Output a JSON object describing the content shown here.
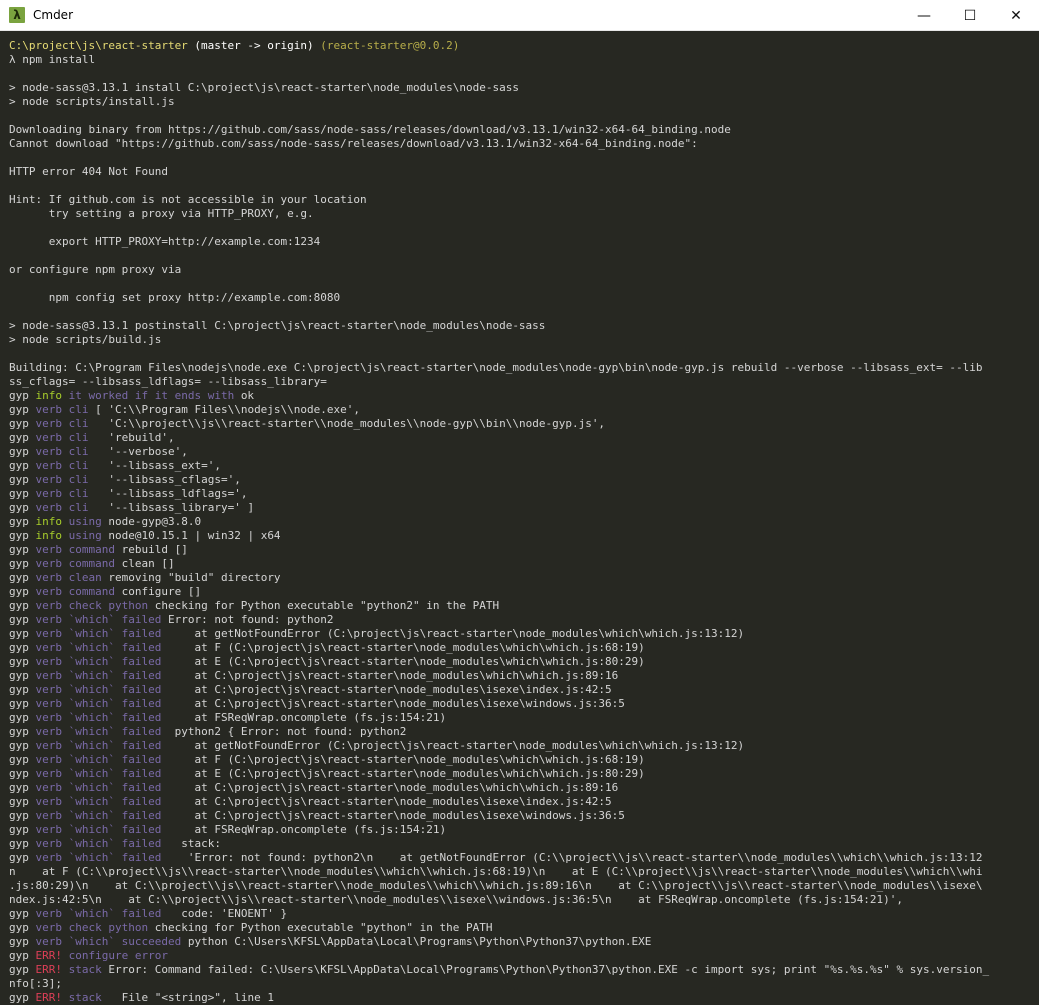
{
  "window": {
    "title": "Cmder",
    "icon": "lambda-icon",
    "icon_glyph": "λ",
    "controls": {
      "minimize": "—",
      "maximize": "☐",
      "close": "✕"
    }
  },
  "colors": {
    "background": "#272822",
    "text": "#d5d5d5",
    "path": "#e6db74",
    "package": "#b8ae4a",
    "info": "#a6cc2b",
    "verb": "#7a6aa8",
    "error": "#dd3f57"
  },
  "terminal": {
    "lines": [
      [
        [
          "C:\\project\\js\\react-starter",
          "path"
        ],
        [
          " (master -> origin)",
          "git"
        ],
        [
          " (react-starter@0.0.2)",
          "pkg"
        ]
      ],
      [
        [
          "λ npm install",
          "default"
        ]
      ],
      [
        [
          "",
          "default"
        ]
      ],
      [
        [
          "> node-sass@3.13.1 install C:\\project\\js\\react-starter\\node_modules\\node-sass",
          "default"
        ]
      ],
      [
        [
          "> node scripts/install.js",
          "default"
        ]
      ],
      [
        [
          "",
          "default"
        ]
      ],
      [
        [
          "Downloading binary from https://github.com/sass/node-sass/releases/download/v3.13.1/win32-x64-64_binding.node",
          "default"
        ]
      ],
      [
        [
          "Cannot download \"https://github.com/sass/node-sass/releases/download/v3.13.1/win32-x64-64_binding.node\":",
          "default"
        ]
      ],
      [
        [
          "",
          "default"
        ]
      ],
      [
        [
          "HTTP error 404 Not Found",
          "default"
        ]
      ],
      [
        [
          "",
          "default"
        ]
      ],
      [
        [
          "Hint: If github.com is not accessible in your location",
          "default"
        ]
      ],
      [
        [
          "      try setting a proxy via HTTP_PROXY, e.g.",
          "default"
        ]
      ],
      [
        [
          "",
          "default"
        ]
      ],
      [
        [
          "      export HTTP_PROXY=http://example.com:1234",
          "default"
        ]
      ],
      [
        [
          "",
          "default"
        ]
      ],
      [
        [
          "or configure npm proxy via",
          "default"
        ]
      ],
      [
        [
          "",
          "default"
        ]
      ],
      [
        [
          "      npm config set proxy http://example.com:8080",
          "default"
        ]
      ],
      [
        [
          "",
          "default"
        ]
      ],
      [
        [
          "> node-sass@3.13.1 postinstall C:\\project\\js\\react-starter\\node_modules\\node-sass",
          "default"
        ]
      ],
      [
        [
          "> node scripts/build.js",
          "default"
        ]
      ],
      [
        [
          "",
          "default"
        ]
      ],
      [
        [
          "Building: C:\\Program Files\\nodejs\\node.exe C:\\project\\js\\react-starter\\node_modules\\node-gyp\\bin\\node-gyp.js rebuild --verbose --libsass_ext= --lib",
          "default"
        ]
      ],
      [
        [
          "ss_cflags= --libsass_ldflags= --libsass_library=",
          "default"
        ]
      ],
      [
        [
          "gyp ",
          "default"
        ],
        [
          "info",
          "green"
        ],
        [
          " it worked if it ends with ",
          "verb"
        ],
        [
          "ok",
          "default"
        ]
      ],
      [
        [
          "gyp ",
          "default"
        ],
        [
          "verb",
          "verb"
        ],
        [
          " cli",
          "verb"
        ],
        [
          " [ 'C:\\\\Program Files\\\\nodejs\\\\node.exe',",
          "default"
        ]
      ],
      [
        [
          "gyp ",
          "default"
        ],
        [
          "verb",
          "verb"
        ],
        [
          " cli",
          "verb"
        ],
        [
          "   'C:\\\\project\\\\js\\\\react-starter\\\\node_modules\\\\node-gyp\\\\bin\\\\node-gyp.js',",
          "default"
        ]
      ],
      [
        [
          "gyp ",
          "default"
        ],
        [
          "verb",
          "verb"
        ],
        [
          " cli",
          "verb"
        ],
        [
          "   'rebuild',",
          "default"
        ]
      ],
      [
        [
          "gyp ",
          "default"
        ],
        [
          "verb",
          "verb"
        ],
        [
          " cli",
          "verb"
        ],
        [
          "   '--verbose',",
          "default"
        ]
      ],
      [
        [
          "gyp ",
          "default"
        ],
        [
          "verb",
          "verb"
        ],
        [
          " cli",
          "verb"
        ],
        [
          "   '--libsass_ext=',",
          "default"
        ]
      ],
      [
        [
          "gyp ",
          "default"
        ],
        [
          "verb",
          "verb"
        ],
        [
          " cli",
          "verb"
        ],
        [
          "   '--libsass_cflags=',",
          "default"
        ]
      ],
      [
        [
          "gyp ",
          "default"
        ],
        [
          "verb",
          "verb"
        ],
        [
          " cli",
          "verb"
        ],
        [
          "   '--libsass_ldflags=',",
          "default"
        ]
      ],
      [
        [
          "gyp ",
          "default"
        ],
        [
          "verb",
          "verb"
        ],
        [
          " cli",
          "verb"
        ],
        [
          "   '--libsass_library=' ]",
          "default"
        ]
      ],
      [
        [
          "gyp ",
          "default"
        ],
        [
          "info",
          "green"
        ],
        [
          " using",
          "verb"
        ],
        [
          " node-gyp@3.8.0",
          "default"
        ]
      ],
      [
        [
          "gyp ",
          "default"
        ],
        [
          "info",
          "green"
        ],
        [
          " using",
          "verb"
        ],
        [
          " node@10.15.1 | win32 | x64",
          "default"
        ]
      ],
      [
        [
          "gyp ",
          "default"
        ],
        [
          "verb",
          "verb"
        ],
        [
          " command",
          "verb"
        ],
        [
          " rebuild []",
          "default"
        ]
      ],
      [
        [
          "gyp ",
          "default"
        ],
        [
          "verb",
          "verb"
        ],
        [
          " command",
          "verb"
        ],
        [
          " clean []",
          "default"
        ]
      ],
      [
        [
          "gyp ",
          "default"
        ],
        [
          "verb",
          "verb"
        ],
        [
          " clean",
          "verb"
        ],
        [
          " removing \"build\" directory",
          "default"
        ]
      ],
      [
        [
          "gyp ",
          "default"
        ],
        [
          "verb",
          "verb"
        ],
        [
          " command",
          "verb"
        ],
        [
          " configure []",
          "default"
        ]
      ],
      [
        [
          "gyp ",
          "default"
        ],
        [
          "verb",
          "verb"
        ],
        [
          " check python",
          "verb"
        ],
        [
          " checking for Python executable \"python2\" in the PATH",
          "default"
        ]
      ],
      [
        [
          "gyp ",
          "default"
        ],
        [
          "verb",
          "verb"
        ],
        [
          " `which` failed",
          "verb"
        ],
        [
          " Error: not found: python2",
          "default"
        ]
      ],
      [
        [
          "gyp ",
          "default"
        ],
        [
          "verb",
          "verb"
        ],
        [
          " `which` failed",
          "verb"
        ],
        [
          "     at getNotFoundError (C:\\project\\js\\react-starter\\node_modules\\which\\which.js:13:12)",
          "default"
        ]
      ],
      [
        [
          "gyp ",
          "default"
        ],
        [
          "verb",
          "verb"
        ],
        [
          " `which` failed",
          "verb"
        ],
        [
          "     at F (C:\\project\\js\\react-starter\\node_modules\\which\\which.js:68:19)",
          "default"
        ]
      ],
      [
        [
          "gyp ",
          "default"
        ],
        [
          "verb",
          "verb"
        ],
        [
          " `which` failed",
          "verb"
        ],
        [
          "     at E (C:\\project\\js\\react-starter\\node_modules\\which\\which.js:80:29)",
          "default"
        ]
      ],
      [
        [
          "gyp ",
          "default"
        ],
        [
          "verb",
          "verb"
        ],
        [
          " `which` failed",
          "verb"
        ],
        [
          "     at C:\\project\\js\\react-starter\\node_modules\\which\\which.js:89:16",
          "default"
        ]
      ],
      [
        [
          "gyp ",
          "default"
        ],
        [
          "verb",
          "verb"
        ],
        [
          " `which` failed",
          "verb"
        ],
        [
          "     at C:\\project\\js\\react-starter\\node_modules\\isexe\\index.js:42:5",
          "default"
        ]
      ],
      [
        [
          "gyp ",
          "default"
        ],
        [
          "verb",
          "verb"
        ],
        [
          " `which` failed",
          "verb"
        ],
        [
          "     at C:\\project\\js\\react-starter\\node_modules\\isexe\\windows.js:36:5",
          "default"
        ]
      ],
      [
        [
          "gyp ",
          "default"
        ],
        [
          "verb",
          "verb"
        ],
        [
          " `which` failed",
          "verb"
        ],
        [
          "     at FSReqWrap.oncomplete (fs.js:154:21)",
          "default"
        ]
      ],
      [
        [
          "gyp ",
          "default"
        ],
        [
          "verb",
          "verb"
        ],
        [
          " `which` failed",
          "verb"
        ],
        [
          "  python2 { Error: not found: python2",
          "default"
        ]
      ],
      [
        [
          "gyp ",
          "default"
        ],
        [
          "verb",
          "verb"
        ],
        [
          " `which` failed",
          "verb"
        ],
        [
          "     at getNotFoundError (C:\\project\\js\\react-starter\\node_modules\\which\\which.js:13:12)",
          "default"
        ]
      ],
      [
        [
          "gyp ",
          "default"
        ],
        [
          "verb",
          "verb"
        ],
        [
          " `which` failed",
          "verb"
        ],
        [
          "     at F (C:\\project\\js\\react-starter\\node_modules\\which\\which.js:68:19)",
          "default"
        ]
      ],
      [
        [
          "gyp ",
          "default"
        ],
        [
          "verb",
          "verb"
        ],
        [
          " `which` failed",
          "verb"
        ],
        [
          "     at E (C:\\project\\js\\react-starter\\node_modules\\which\\which.js:80:29)",
          "default"
        ]
      ],
      [
        [
          "gyp ",
          "default"
        ],
        [
          "verb",
          "verb"
        ],
        [
          " `which` failed",
          "verb"
        ],
        [
          "     at C:\\project\\js\\react-starter\\node_modules\\which\\which.js:89:16",
          "default"
        ]
      ],
      [
        [
          "gyp ",
          "default"
        ],
        [
          "verb",
          "verb"
        ],
        [
          " `which` failed",
          "verb"
        ],
        [
          "     at C:\\project\\js\\react-starter\\node_modules\\isexe\\index.js:42:5",
          "default"
        ]
      ],
      [
        [
          "gyp ",
          "default"
        ],
        [
          "verb",
          "verb"
        ],
        [
          " `which` failed",
          "verb"
        ],
        [
          "     at C:\\project\\js\\react-starter\\node_modules\\isexe\\windows.js:36:5",
          "default"
        ]
      ],
      [
        [
          "gyp ",
          "default"
        ],
        [
          "verb",
          "verb"
        ],
        [
          " `which` failed",
          "verb"
        ],
        [
          "     at FSReqWrap.oncomplete (fs.js:154:21)",
          "default"
        ]
      ],
      [
        [
          "gyp ",
          "default"
        ],
        [
          "verb",
          "verb"
        ],
        [
          " `which` failed",
          "verb"
        ],
        [
          "   stack:",
          "default"
        ]
      ],
      [
        [
          "gyp ",
          "default"
        ],
        [
          "verb",
          "verb"
        ],
        [
          " `which` failed",
          "verb"
        ],
        [
          "    'Error: not found: python2\\n    at getNotFoundError (C:\\\\project\\\\js\\\\react-starter\\\\node_modules\\\\which\\\\which.js:13:12",
          "default"
        ]
      ],
      [
        [
          "n    at F (C:\\\\project\\\\js\\\\react-starter\\\\node_modules\\\\which\\\\which.js:68:19)\\n    at E (C:\\\\project\\\\js\\\\react-starter\\\\node_modules\\\\which\\\\whi",
          "default"
        ]
      ],
      [
        [
          ".js:80:29)\\n    at C:\\\\project\\\\js\\\\react-starter\\\\node_modules\\\\which\\\\which.js:89:16\\n    at C:\\\\project\\\\js\\\\react-starter\\\\node_modules\\\\isexe\\",
          "default"
        ]
      ],
      [
        [
          "ndex.js:42:5\\n    at C:\\\\project\\\\js\\\\react-starter\\\\node_modules\\\\isexe\\\\windows.js:36:5\\n    at FSReqWrap.oncomplete (fs.js:154:21)',",
          "default"
        ]
      ],
      [
        [
          "gyp ",
          "default"
        ],
        [
          "verb",
          "verb"
        ],
        [
          " `which` failed",
          "verb"
        ],
        [
          "   code: 'ENOENT' }",
          "default"
        ]
      ],
      [
        [
          "gyp ",
          "default"
        ],
        [
          "verb",
          "verb"
        ],
        [
          " check python",
          "verb"
        ],
        [
          " checking for Python executable \"python\" in the PATH",
          "default"
        ]
      ],
      [
        [
          "gyp ",
          "default"
        ],
        [
          "verb",
          "verb"
        ],
        [
          " `which` succeeded",
          "verb"
        ],
        [
          " python C:\\Users\\KFSL\\AppData\\Local\\Programs\\Python\\Python37\\python.EXE",
          "default"
        ]
      ],
      [
        [
          "gyp ",
          "default"
        ],
        [
          "ERR!",
          "red"
        ],
        [
          " configure error",
          "verb"
        ]
      ],
      [
        [
          "gyp ",
          "default"
        ],
        [
          "ERR!",
          "red"
        ],
        [
          " stack",
          "verb"
        ],
        [
          " Error: Command failed: C:\\Users\\KFSL\\AppData\\Local\\Programs\\Python\\Python37\\python.EXE -c import sys; print \"%s.%s.%s\" % sys.version_",
          "default"
        ]
      ],
      [
        [
          "nfo[:3];",
          "default"
        ]
      ],
      [
        [
          "gyp ",
          "default"
        ],
        [
          "ERR!",
          "red"
        ],
        [
          " stack",
          "verb"
        ],
        [
          "   File \"<string>\", line 1",
          "default"
        ]
      ]
    ]
  }
}
